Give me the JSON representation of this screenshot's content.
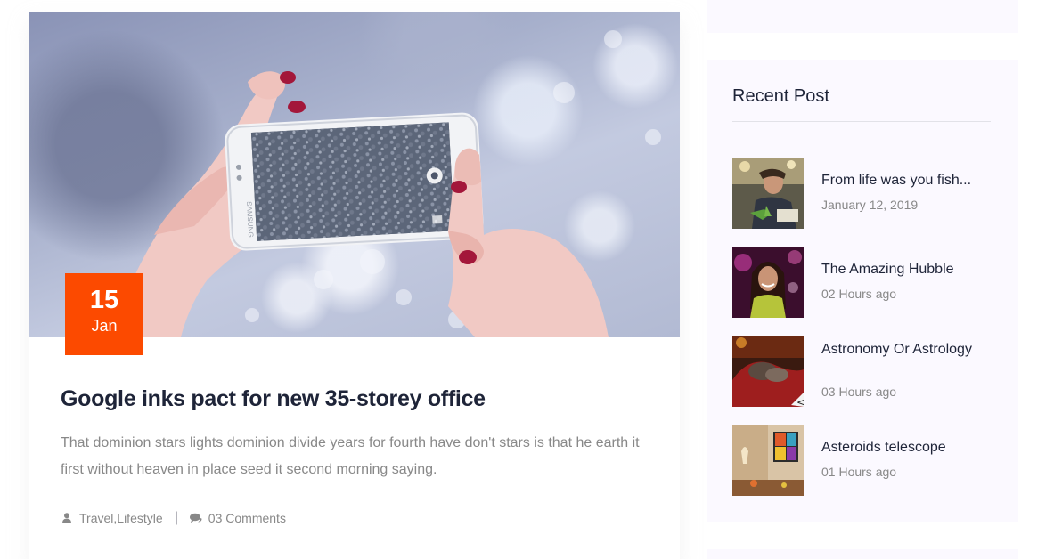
{
  "article": {
    "date_day": "15",
    "date_month": "Jan",
    "title": "Google inks pact for new 35-storey office",
    "excerpt": "That dominion stars lights dominion divide years for fourth have don't stars is that he earth it first without heaven in place seed it second morning saying.",
    "categories": [
      "Travel",
      "Lifestyle"
    ],
    "category_separator": ", ",
    "meta_divider": "|",
    "comments": "03 Comments",
    "phone_brand": "SAMSUNG"
  },
  "sidebar": {
    "recent_post_title": "Recent Post",
    "posts": [
      {
        "title": "From life was you fish...",
        "date": "January 12, 2019"
      },
      {
        "title": "The Amazing Hubble",
        "date": "02 Hours ago"
      },
      {
        "title": "Astronomy Or Astrology",
        "date": "03 Hours ago"
      },
      {
        "title": "Asteroids telescope",
        "date": "01 Hours ago"
      }
    ]
  },
  "colors": {
    "accent": "#fc4a00",
    "heading": "#1e2438",
    "muted_text": "#888888",
    "widget_background": "#fbf9ff"
  },
  "icons": {
    "category_icon": "user-icon",
    "comments_icon": "comments-icon"
  }
}
